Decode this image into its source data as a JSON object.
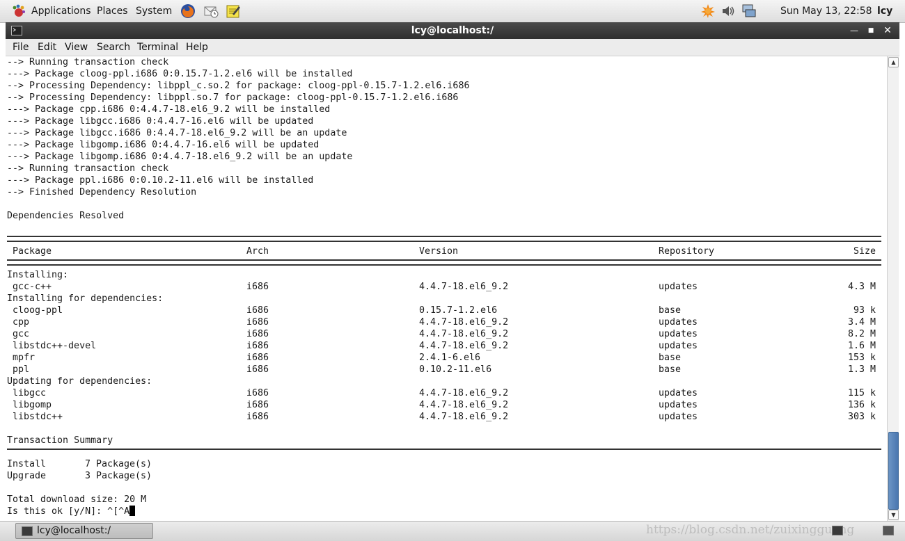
{
  "top_panel": {
    "menus": [
      "Applications",
      "Places",
      "System"
    ],
    "clock": "Sun May 13, 22:58",
    "user": "lcy",
    "icons": [
      "gnome-foot-icon",
      "firefox-icon",
      "mail-icon",
      "notes-icon",
      "update-icon",
      "volume-icon",
      "network-icon"
    ]
  },
  "window": {
    "title": "lcy@localhost:/",
    "controls": [
      "minimize-icon",
      "maximize-icon",
      "close-icon"
    ]
  },
  "menubar": [
    "File",
    "Edit",
    "View",
    "Search",
    "Terminal",
    "Help"
  ],
  "terminal": {
    "log": [
      "--> Running transaction check",
      "---> Package cloog-ppl.i686 0:0.15.7-1.2.el6 will be installed",
      "--> Processing Dependency: libppl_c.so.2 for package: cloog-ppl-0.15.7-1.2.el6.i686",
      "--> Processing Dependency: libppl.so.7 for package: cloog-ppl-0.15.7-1.2.el6.i686",
      "---> Package cpp.i686 0:4.4.7-18.el6_9.2 will be installed",
      "---> Package libgcc.i686 0:4.4.7-16.el6 will be updated",
      "---> Package libgcc.i686 0:4.4.7-18.el6_9.2 will be an update",
      "---> Package libgomp.i686 0:4.4.7-16.el6 will be updated",
      "---> Package libgomp.i686 0:4.4.7-18.el6_9.2 will be an update",
      "--> Running transaction check",
      "---> Package ppl.i686 0:0.10.2-11.el6 will be installed",
      "--> Finished Dependency Resolution"
    ],
    "resolved": "Dependencies Resolved",
    "table": {
      "headers": [
        "Package",
        "Arch",
        "Version",
        "Repository",
        "Size"
      ],
      "groups": [
        {
          "title": "Installing:",
          "rows": [
            [
              "gcc-c++",
              "i686",
              "4.4.7-18.el6_9.2",
              "updates",
              "4.3 M"
            ]
          ]
        },
        {
          "title": "Installing for dependencies:",
          "rows": [
            [
              "cloog-ppl",
              "i686",
              "0.15.7-1.2.el6",
              "base",
              "93 k"
            ],
            [
              "cpp",
              "i686",
              "4.4.7-18.el6_9.2",
              "updates",
              "3.4 M"
            ],
            [
              "gcc",
              "i686",
              "4.4.7-18.el6_9.2",
              "updates",
              "8.2 M"
            ],
            [
              "libstdc++-devel",
              "i686",
              "4.4.7-18.el6_9.2",
              "updates",
              "1.6 M"
            ],
            [
              "mpfr",
              "i686",
              "2.4.1-6.el6",
              "base",
              "153 k"
            ],
            [
              "ppl",
              "i686",
              "0.10.2-11.el6",
              "base",
              "1.3 M"
            ]
          ]
        },
        {
          "title": "Updating for dependencies:",
          "rows": [
            [
              "libgcc",
              "i686",
              "4.4.7-18.el6_9.2",
              "updates",
              "115 k"
            ],
            [
              "libgomp",
              "i686",
              "4.4.7-18.el6_9.2",
              "updates",
              "136 k"
            ],
            [
              "libstdc++",
              "i686",
              "4.4.7-18.el6_9.2",
              "updates",
              "303 k"
            ]
          ]
        }
      ]
    },
    "summary_title": "Transaction Summary",
    "summary": [
      {
        "label": "Install",
        "value": "7 Package(s)"
      },
      {
        "label": "Upgrade",
        "value": "3 Package(s)"
      }
    ],
    "download_size": "Total download size: 20 M",
    "prompt": "Is this ok [y/N]: ^[^A"
  },
  "bottom_panel": {
    "task": "lcy@localhost:/",
    "watermark": "https://blog.csdn.net/zuixingguang"
  }
}
